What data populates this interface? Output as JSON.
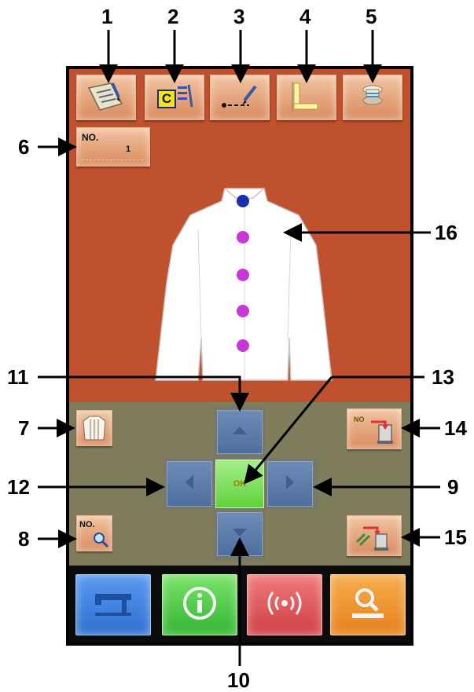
{
  "callouts": {
    "c1": "1",
    "c2": "2",
    "c3": "3",
    "c4": "4",
    "c5": "5",
    "c6": "6",
    "c7": "7",
    "c8": "8",
    "c9": "9",
    "c10": "10",
    "c11": "11",
    "c12": "12",
    "c13": "13",
    "c14": "14",
    "c15": "15",
    "c16": "16"
  },
  "toolbar": {
    "data_edit_icon": "clipboard-pencil-icon",
    "counter_letter": "C",
    "stitch_icon": "stitch-pencil-icon",
    "feed_icon": "l-shape-icon",
    "bobbin_icon": "bobbin-icon"
  },
  "pattern_no": {
    "label": "NO.",
    "value": "1"
  },
  "left_panel": {
    "garment_icon": "shirt-icon",
    "search_no_label": "NO."
  },
  "right_panel": {
    "set_no_label": "NO",
    "bobbin_winder_icon": "thread-stand-icon"
  },
  "nav": {
    "ok_label": "OK"
  },
  "bottom_buttons": [
    {
      "name": "sewing-machine",
      "color": "#2f6fd0"
    },
    {
      "name": "information",
      "color": "#3ec23c"
    },
    {
      "name": "communication",
      "color": "#d84a4a"
    },
    {
      "name": "search",
      "color": "#e58a1f"
    }
  ],
  "colors": {
    "background": "#c0512e",
    "panel": "#7f7d5c",
    "button_top": "#f1c4a1",
    "button_bottom": "#d98a5e",
    "nav_blue": "#5878a8",
    "ok_green": "#6ed64a",
    "top_button_marker": "#1a2fb0",
    "button_marker": "#c838d8"
  }
}
